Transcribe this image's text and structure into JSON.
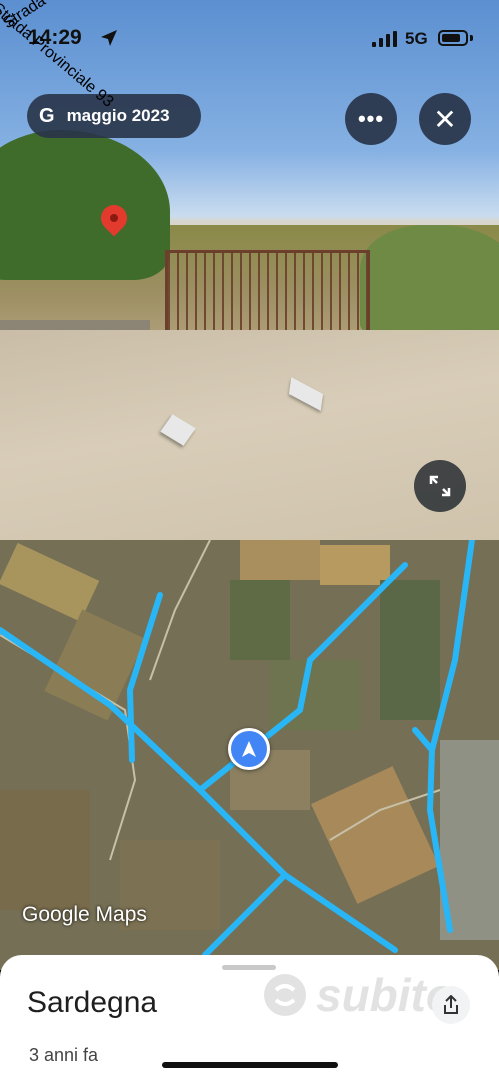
{
  "status_bar": {
    "time": "14:29",
    "network": "5G",
    "battery_level": 0.8
  },
  "street_view": {
    "date_chip": {
      "brand_glyph": "G",
      "label": "maggio 2023"
    },
    "more_label": "•••",
    "close_label": "✕"
  },
  "map": {
    "roads": [
      "Strada Provinciale 93",
      "Strada Comu"
    ],
    "attribution": "Google Maps"
  },
  "sheet": {
    "place": "Sardegna",
    "age": "3 anni fa"
  },
  "watermark": {
    "text": "subito"
  },
  "colors": {
    "route": "#29b6f6",
    "nav_dot": "#4285f4",
    "chip_bg": "#283448"
  }
}
